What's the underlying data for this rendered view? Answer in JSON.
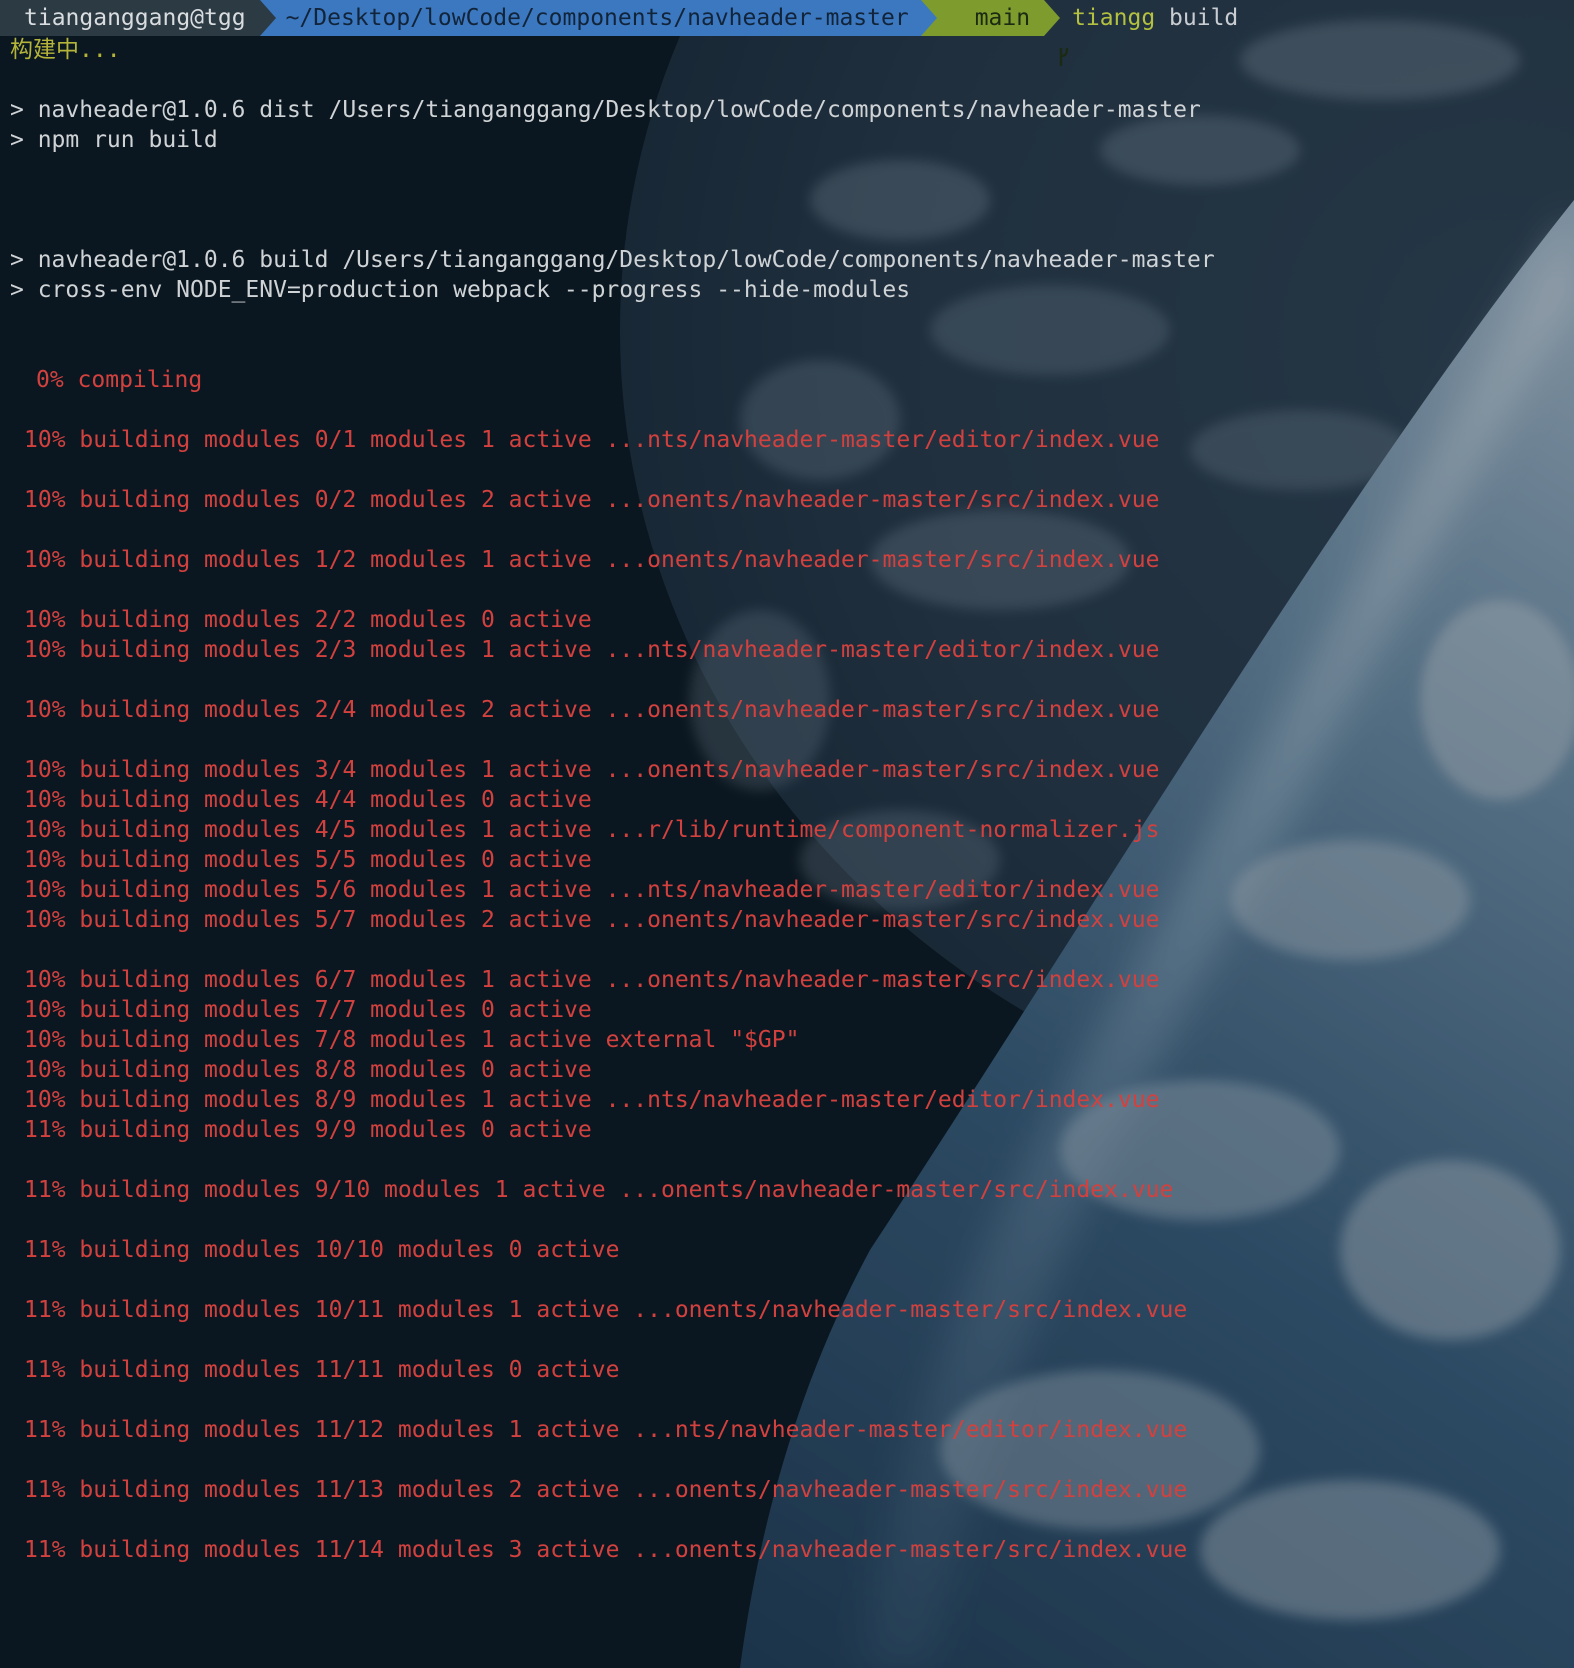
{
  "prompt": {
    "user": "tianganggang@tgg",
    "path": "~/Desktop/lowCode/components/navheader-master",
    "branch_icon": "git-branch-icon",
    "branch": "main",
    "command": "tiangg",
    "argument": "build"
  },
  "status": "构建中...",
  "npm": [
    "> navheader@1.0.6 dist /Users/tianganggang/Desktop/lowCode/components/navheader-master",
    "> npm run build",
    "> navheader@1.0.6 build /Users/tianganggang/Desktop/lowCode/components/navheader-master",
    "> cross-env NODE_ENV=production webpack --progress --hide-modules"
  ],
  "compiling": "0% compiling",
  "build_lines": [
    "10% building modules 0/1 modules 1 active ...nts/navheader-master/editor/index.vue",
    "10% building modules 0/2 modules 2 active ...onents/navheader-master/src/index.vue",
    "10% building modules 1/2 modules 1 active ...onents/navheader-master/src/index.vue",
    "10% building modules 2/2 modules 0 active",
    "10% building modules 2/3 modules 1 active ...nts/navheader-master/editor/index.vue",
    "10% building modules 2/4 modules 2 active ...onents/navheader-master/src/index.vue",
    "10% building modules 3/4 modules 1 active ...onents/navheader-master/src/index.vue",
    "10% building modules 4/4 modules 0 active",
    "10% building modules 4/5 modules 1 active ...r/lib/runtime/component-normalizer.js",
    "10% building modules 5/5 modules 0 active",
    "10% building modules 5/6 modules 1 active ...nts/navheader-master/editor/index.vue",
    "10% building modules 5/7 modules 2 active ...onents/navheader-master/src/index.vue",
    "10% building modules 6/7 modules 1 active ...onents/navheader-master/src/index.vue",
    "10% building modules 7/7 modules 0 active",
    "10% building modules 7/8 modules 1 active external \"$GP\"",
    "10% building modules 8/8 modules 0 active",
    "10% building modules 8/9 modules 1 active ...nts/navheader-master/editor/index.vue",
    "11% building modules 9/9 modules 0 active",
    "11% building modules 9/10 modules 1 active ...onents/navheader-master/src/index.vue",
    "11% building modules 10/10 modules 0 active",
    "11% building modules 10/11 modules 1 active ...onents/navheader-master/src/index.vue",
    "11% building modules 11/11 modules 0 active",
    "11% building modules 11/12 modules 1 active ...nts/navheader-master/editor/index.vue",
    "11% building modules 11/13 modules 2 active ...onents/navheader-master/src/index.vue",
    "11% building modules 11/14 modules 3 active ...onents/navheader-master/src/index.vue"
  ],
  "colors": {
    "background": "#0b1620",
    "prompt_user_bg": "#2c3a44",
    "prompt_path_bg": "#3b78c0",
    "prompt_git_bg": "#7e9b2d",
    "status_text": "#b4b33a",
    "build_text": "#d3413f"
  },
  "wallpaper": "earth-from-space"
}
